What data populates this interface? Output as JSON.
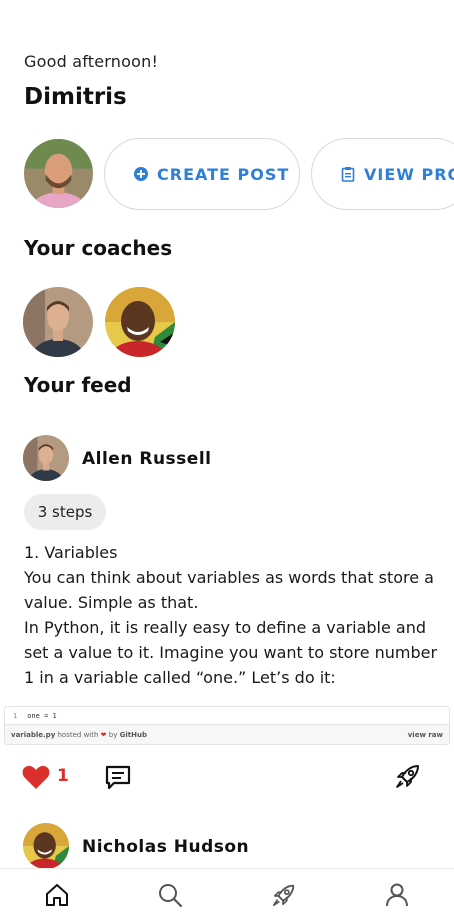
{
  "header": {
    "greeting": "Good afternoon!",
    "username": "Dimitris"
  },
  "actions": {
    "create_post_label": "CREATE POST",
    "view_profile_label": "VIEW PRO"
  },
  "sections": {
    "coaches_title": "Your coaches",
    "feed_title": "Your feed"
  },
  "posts": [
    {
      "author": "Allen Russell",
      "steps_badge": "3 steps",
      "lines": [
        "1. Variables",
        "You can think about variables as words that store a value. Simple as that.",
        "In Python, it is really easy to define a variable and set a value to it. Imagine you want to store number 1 in a variable called “one.” Let’s do it:"
      ],
      "gist": {
        "line_number": "1",
        "code": "one = 1",
        "filename": "variable.py",
        "hosted_with": "hosted with",
        "by": "by",
        "host": "GitHub",
        "view_raw": "view raw"
      },
      "likes": "1"
    },
    {
      "author": "Nicholas Hudson"
    }
  ],
  "icons": {
    "like": "heart-icon",
    "comment": "comment-icon",
    "share": "rocket-icon",
    "tabs": [
      "home-icon",
      "search-icon",
      "rocket-icon",
      "profile-icon"
    ]
  },
  "colors": {
    "accent": "#2f7fd9",
    "like": "#d9302c",
    "chip": "#ececec"
  }
}
